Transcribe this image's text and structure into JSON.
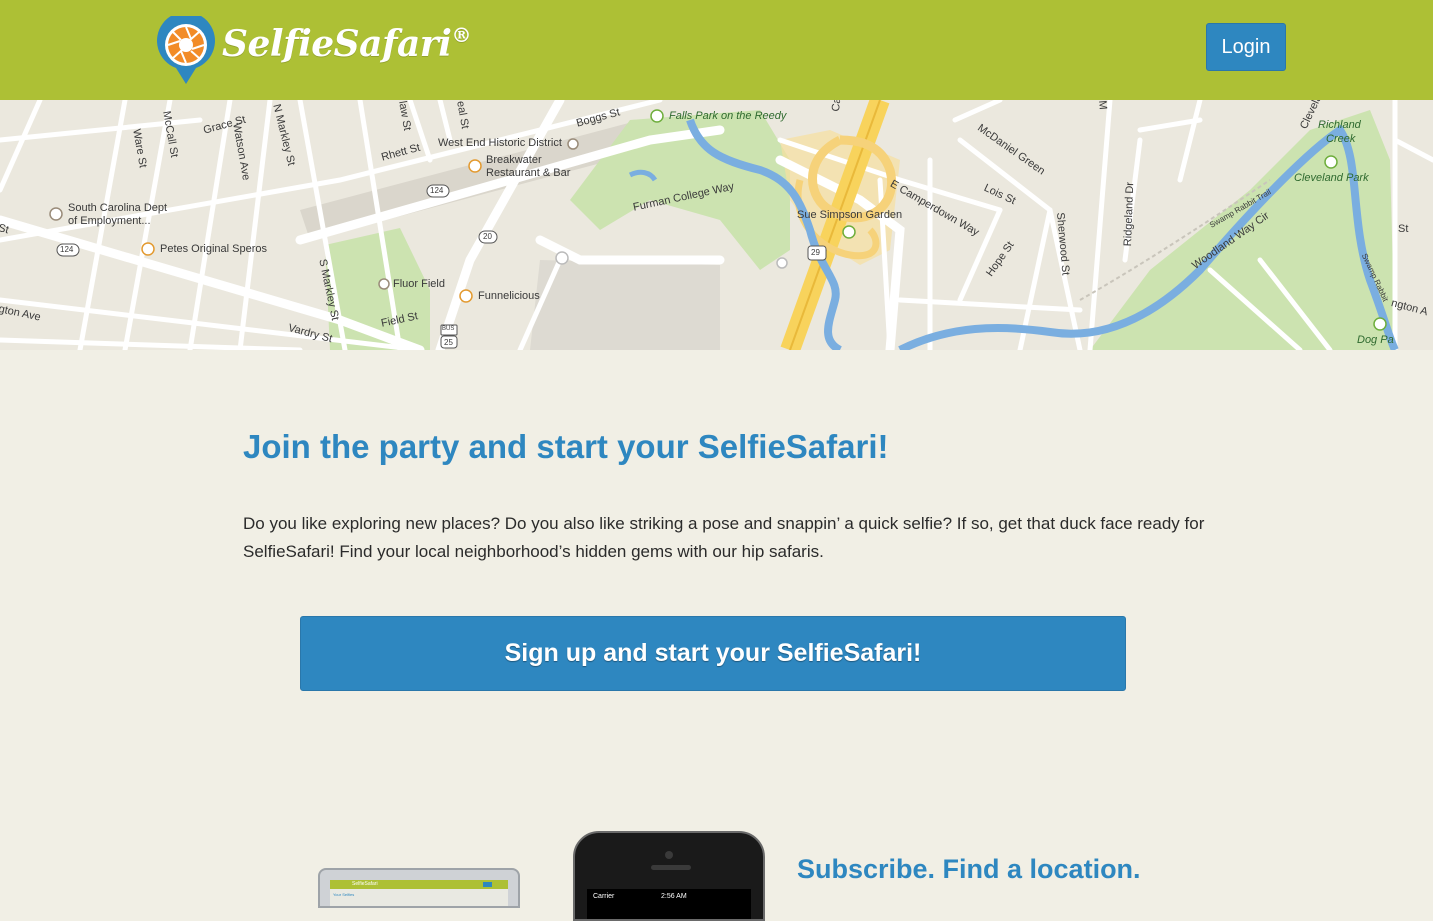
{
  "header": {
    "logo_text": "SelfieSafari",
    "logo_mark": "®",
    "login_label": "Login",
    "bg_color": "#adc035"
  },
  "map": {
    "labels": {
      "grace_st": "Grace St",
      "mccall_st": "McCall St",
      "ware_st": "Ware St",
      "watson_ave": "Watson Ave",
      "n_markley_st": "N Markley St",
      "rhett_st": "Rhett St",
      "west_end": "West End Historic District",
      "breakwater": "Breakwater",
      "breakwater2": "Restaurant & Bar",
      "boggs_st": "Boggs St",
      "falls_park": "Falls Park on the Reedy",
      "sc_dept": "South Carolina Dept",
      "sc_dept2": "of Employment...",
      "petes": "Petes Original Speros",
      "r124a": "124",
      "r124b": "124",
      "r20": "20",
      "r29": "29",
      "r25": "25",
      "bus": "BUS",
      "furman": "Furman College Way",
      "sue_simpson": "Sue Simpson Garden",
      "e_camperdown": "E Camperdown Way",
      "mcdaniel": "McDaniel Green",
      "lois_st": "Lois St",
      "hope_st": "Hope St",
      "sherwood": "Sherwood St",
      "ridgeland": "Ridgeland Dr",
      "richland1": "Richland",
      "richland2": "Creek",
      "cleveland_park": "Cleveland Park",
      "swamp_rabbit": "Swamp Rabbit Trail",
      "woodland": "Woodland Way Cir",
      "swamp_rabbit2": "Swamp Rabbit",
      "dog_park": "Dog Pa",
      "st": "St",
      "s_markley": "S Markley St",
      "fluor_field": "Fluor Field",
      "funnelicious": "Funnelicious",
      "field_st": "Field St",
      "vardry_st": "Vardry St",
      "gton_ave": "gton Ave",
      "st_left": "St",
      "cleveland_top": "Clevela",
      "rington": "ngton A",
      "cal": "Cal",
      "law_st": "law St",
      "eal_st": "eal St",
      "m_top": "M"
    }
  },
  "main": {
    "headline": "Join the party and start your SelfieSafari!",
    "intro": "Do you like exploring new places? Do you also like striking a pose and snappin’ a quick selfie? If so, get that duck face ready for SelfieSafari! Find your local neighborhood’s hidden gems with our hip safaris.",
    "signup_label": "Sign up and start your SelfieSafari!",
    "subscribe_heading": "Subscribe. Find a location."
  },
  "devices": {
    "laptop_logo": "SelfieSafari",
    "laptop_sub": "Your Selfies",
    "phone_carrier": "Carrier",
    "phone_time": "2:56 AM"
  },
  "colors": {
    "accent": "#2e87c0",
    "page_bg": "#f1efe5",
    "header_green": "#adc035"
  }
}
